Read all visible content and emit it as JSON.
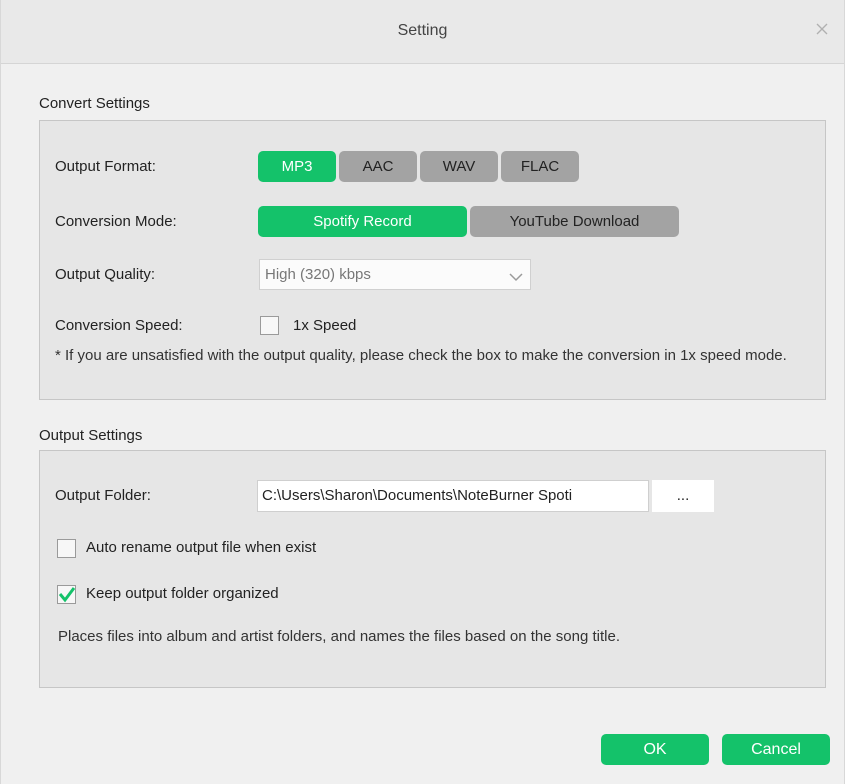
{
  "window": {
    "title": "Setting",
    "close_icon": "close-icon"
  },
  "convert_settings": {
    "section_title": "Convert Settings",
    "output_format": {
      "label": "Output Format:",
      "options": [
        "MP3",
        "AAC",
        "WAV",
        "FLAC"
      ],
      "selected": "MP3"
    },
    "conversion_mode": {
      "label": "Conversion Mode:",
      "options": [
        "Spotify Record",
        "YouTube Download"
      ],
      "selected": "Spotify Record"
    },
    "output_quality": {
      "label": "Output Quality:",
      "value": "High (320) kbps"
    },
    "conversion_speed": {
      "label": "Conversion Speed:",
      "checkbox_label": "1x Speed",
      "checked": false
    },
    "note": "* If you are unsatisfied with the output quality, please check the box to make the conversion in 1x speed mode."
  },
  "output_settings": {
    "section_title": "Output Settings",
    "output_folder": {
      "label": "Output Folder:",
      "value": "C:\\Users\\Sharon\\Documents\\NoteBurner Spoti",
      "browse_label": "..."
    },
    "auto_rename": {
      "label": "Auto rename output file when exist",
      "checked": false
    },
    "keep_organized": {
      "label": "Keep output folder organized",
      "checked": true
    },
    "description": "Places files into album and artist folders, and names the files based on the song title."
  },
  "footer": {
    "ok_label": "OK",
    "cancel_label": "Cancel"
  },
  "colors": {
    "accent": "#14c26a",
    "inactive_segment": "#a3a3a3",
    "panel_bg": "#e6e6e6"
  }
}
